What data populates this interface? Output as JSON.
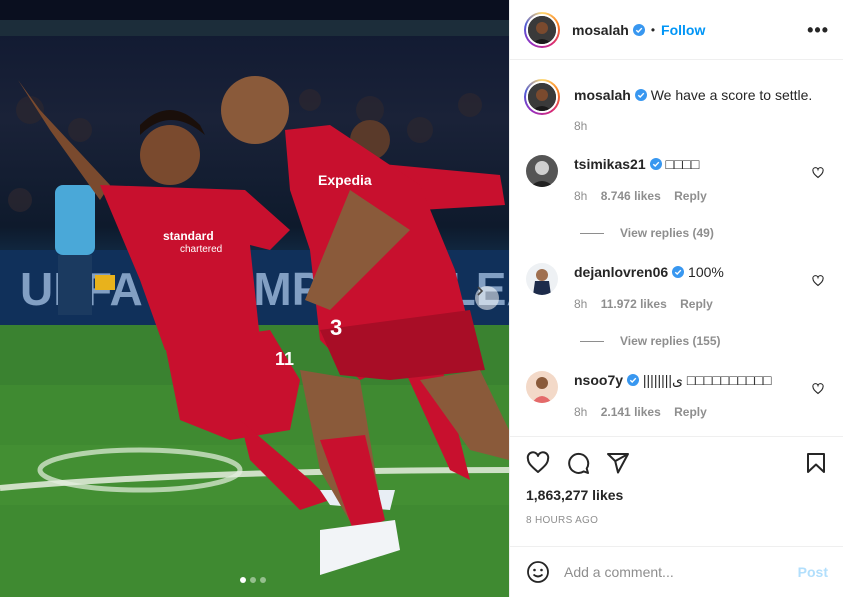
{
  "header": {
    "username": "mosalah",
    "separator": "•",
    "follow_label": "Follow",
    "more_label": "•••"
  },
  "caption": {
    "username": "mosalah",
    "text": "We have a score to settle.",
    "age": "8h"
  },
  "comments": [
    {
      "username": "tsimikas21",
      "text": "□□□□",
      "age": "8h",
      "likes": "8.746 likes",
      "reply_label": "Reply",
      "view_replies": "View replies (49)"
    },
    {
      "username": "dejanlovren06",
      "text": "100%",
      "age": "8h",
      "likes": "11.972 likes",
      "reply_label": "Reply",
      "view_replies": "View replies (155)"
    },
    {
      "username": "nsoo7y",
      "text": "||||||||ی □□□□□□□□□□",
      "age": "8h",
      "likes": "2.141 likes",
      "reply_label": "Reply"
    }
  ],
  "post": {
    "likes": "1,863,277 likes",
    "time": "8 HOURS AGO"
  },
  "add_comment": {
    "placeholder": "Add a comment...",
    "post_label": "Post"
  },
  "carousel": {
    "slides": 3,
    "active": 0
  },
  "icons": [
    "heart-icon",
    "comment-icon",
    "share-icon",
    "bookmark-icon",
    "emoji-icon",
    "verified-icon",
    "chevron-right-icon"
  ],
  "colors": {
    "accent": "#0095f6",
    "verified": "#3897f0",
    "post_disabled": "#b2dffc",
    "jersey": "#c8102e"
  }
}
